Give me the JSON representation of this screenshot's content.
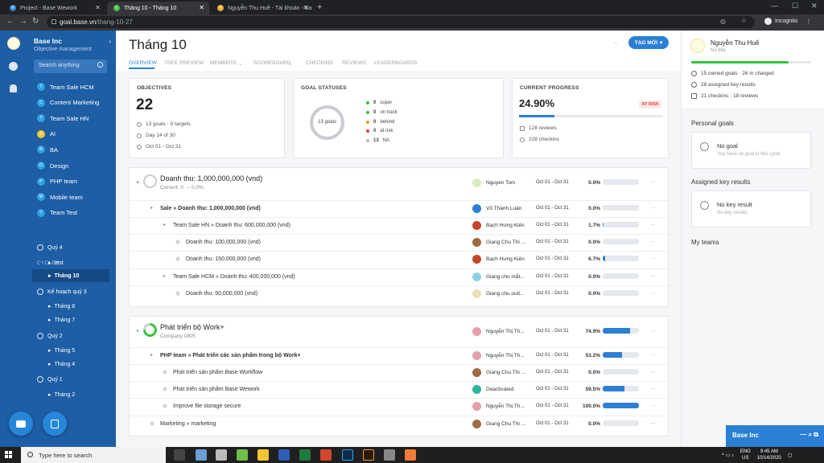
{
  "browser": {
    "tabs": [
      {
        "label": "Project - Base Wework",
        "icon": "wework-icon",
        "active": false
      },
      {
        "label": "Tháng 10 - Tháng 10",
        "icon": "goal-icon",
        "active": true
      },
      {
        "label": "Nguyễn Thu Huế - Tài khoản - Ba",
        "icon": "account-icon",
        "active": false
      }
    ],
    "url_domain": "goal.base.vn",
    "url_path": "/thang-10-27",
    "profile": "Incognito"
  },
  "sidebar": {
    "company": "Base Inc",
    "subtitle": "Objective management",
    "search_placeholder": "Search anything",
    "teams": [
      {
        "letter": "T",
        "label": "Team Sale HCM",
        "color": "#2fa0e6"
      },
      {
        "letter": "C",
        "label": "Content Marketing",
        "color": "#2fa0e6"
      },
      {
        "letter": "T",
        "label": "Team Sale HN",
        "color": "#2fa0e6"
      },
      {
        "letter": "A",
        "label": "AI",
        "color": "#f2c530"
      },
      {
        "letter": "B",
        "label": "BA",
        "color": "#2fa0e6"
      },
      {
        "letter": "D",
        "label": "Design",
        "color": "#2fa0e6"
      },
      {
        "letter": "P",
        "label": "PHP team",
        "color": "#2fa0e6"
      },
      {
        "letter": "M",
        "label": "Mobile team",
        "color": "#2fa0e6"
      },
      {
        "letter": "T",
        "label": "Team Test",
        "color": "#2fa0e6"
      }
    ],
    "cycles_heading": "CYCLES",
    "cycles": {
      "q4": "Quý 4",
      "test": "test",
      "thang10": "Tháng 10",
      "kh3": "Kế hoạch quý 3",
      "thang8": "Tháng 8",
      "thang7": "Tháng 7",
      "q2": "Quý 2",
      "thang5": "Tháng 5",
      "thang4": "Tháng 4",
      "q1": "Quý 1",
      "thang2": "Tháng 2"
    }
  },
  "header": {
    "title": "Tháng 10",
    "create_label": "TẠO MỚI",
    "tabs": [
      "OVERVIEW",
      "TREE PREVIEW",
      "MEMBERS",
      "SCOREBOARD",
      "CHECKINS",
      "REVIEWS",
      "LEADERBOARDS"
    ]
  },
  "objectives": {
    "title": "OBJECTIVES",
    "count": "22",
    "goals": "13 goals · 9 targets",
    "day": "Day 14 of 30",
    "range": "Oct 01 - Oct 31"
  },
  "goal_statuses": {
    "title": "GOAL STATUSES",
    "center": "13 goals",
    "items": [
      {
        "count": "0",
        "label": "super",
        "color": "#36c23c"
      },
      {
        "count": "0",
        "label": "on track",
        "color": "#36c23c"
      },
      {
        "count": "0",
        "label": "behind",
        "color": "#f29b30"
      },
      {
        "count": "0",
        "label": "at risk",
        "color": "#e0413b"
      },
      {
        "count": "13",
        "label": "NA",
        "color": "#b5b9bf"
      }
    ]
  },
  "current_progress": {
    "title": "CURRENT PROGRESS",
    "value": "24.90%",
    "fraction": 0.249,
    "badge": "AT RISK",
    "reviews": "128 reviews",
    "checkins": "228 checkins"
  },
  "goals": [
    {
      "title": "Doanh thu: 1,000,000,000 (vnd)",
      "subtitle": "Current: 0 → 0.0%",
      "rows": [
        {
          "text": "Sale » Doanh thu: 1,000,000,000 (vnd)",
          "owner": "Võ Thành Luân",
          "date": "Oct 01 - Oct 31",
          "pct": "0.0%",
          "fill": 0,
          "bold": true
        },
        {
          "text": "Team Sale HN » Doanh thu: 600,000,000 (vnd)",
          "owner": "Bạch Hưng Kiên",
          "date": "Oct 01 - Oct 31",
          "pct": "1.7%",
          "fill": 0.017
        },
        {
          "text": "Doanh thu: 100,000,000 (vnd)",
          "owner": "Giang Chu Thi ...",
          "date": "Oct 01 - Oct 31",
          "pct": "0.0%",
          "fill": 0
        },
        {
          "text": "Doanh thu: 150,000,000 (vnd)",
          "owner": "Bạch Hưng Kiên",
          "date": "Oct 01 - Oct 31",
          "pct": "6.7%",
          "fill": 0.067
        },
        {
          "text": "Team Sale HCM » Doanh thu: 400,000,000 (vnd)",
          "owner": "Giang chu mắt...",
          "date": "Oct 01 - Oct 31",
          "pct": "0.0%",
          "fill": 0
        },
        {
          "text": "Doanh thu: 50,000,000 (vnd)",
          "owner": "Giang chu outl...",
          "date": "Oct 01 - Oct 31",
          "pct": "0.0%",
          "fill": 0
        }
      ],
      "owner": "Nguyen Tom",
      "date": "Oct 01 - Oct 31",
      "pct": "0.0%",
      "fill": 0
    },
    {
      "title": "Phát triển bộ Work+",
      "subtitle": "Company OKR",
      "owner": "Nguyễn Thị Th...",
      "date": "Oct 01 - Oct 31",
      "pct": "74.9%",
      "fill": 0.749,
      "rows": [
        {
          "text": "PHP team » Phát triển các sản phẩm trong bộ Work+",
          "owner": "Nguyễn Thị Th...",
          "date": "Oct 01 - Oct 31",
          "pct": "53.2%",
          "fill": 0.532,
          "bold": true
        },
        {
          "text": "Phát triển sản phẩm Base Workflow",
          "owner": "Giang Chu Thi ...",
          "date": "Oct 01 - Oct 31",
          "pct": "0.0%",
          "fill": 0
        },
        {
          "text": "Phát triển sản phẩm Base Wework",
          "owner": "Deactivated",
          "date": "Oct 01 - Oct 31",
          "pct": "59.5%",
          "fill": 0.595
        },
        {
          "text": "Improve file storage secure",
          "owner": "Nguyễn Thị Th...",
          "date": "Oct 01 - Oct 31",
          "pct": "100.0%",
          "fill": 1.0
        },
        {
          "text": "Marketing » marketing",
          "owner": "Giang Chu Thi ...",
          "date": "Oct 01 - Oct 31",
          "pct": "0.0%",
          "fill": 0
        }
      ]
    }
  ],
  "profile": {
    "name": "Nguyễn Thu Huế",
    "title": "No title",
    "progress": 0.81,
    "owned": "15 owned goals · 26 in charged",
    "assigned": "28 assigned key results",
    "checkins": "21 checkins · 18 reviews",
    "personal_heading": "Personal goals",
    "no_goal": "No goal",
    "no_goal_sub": "You have no goal in this cycle",
    "assigned_heading": "Assigned key results",
    "no_kr": "No key result",
    "no_kr_sub": "No key results",
    "teams_heading": "My teams"
  },
  "chat_label": "Base Inc",
  "taskbar": {
    "search": "Type here to search",
    "lang": "ENG",
    "region": "US",
    "time": "9:45 AM",
    "date": "10/14/2020"
  }
}
